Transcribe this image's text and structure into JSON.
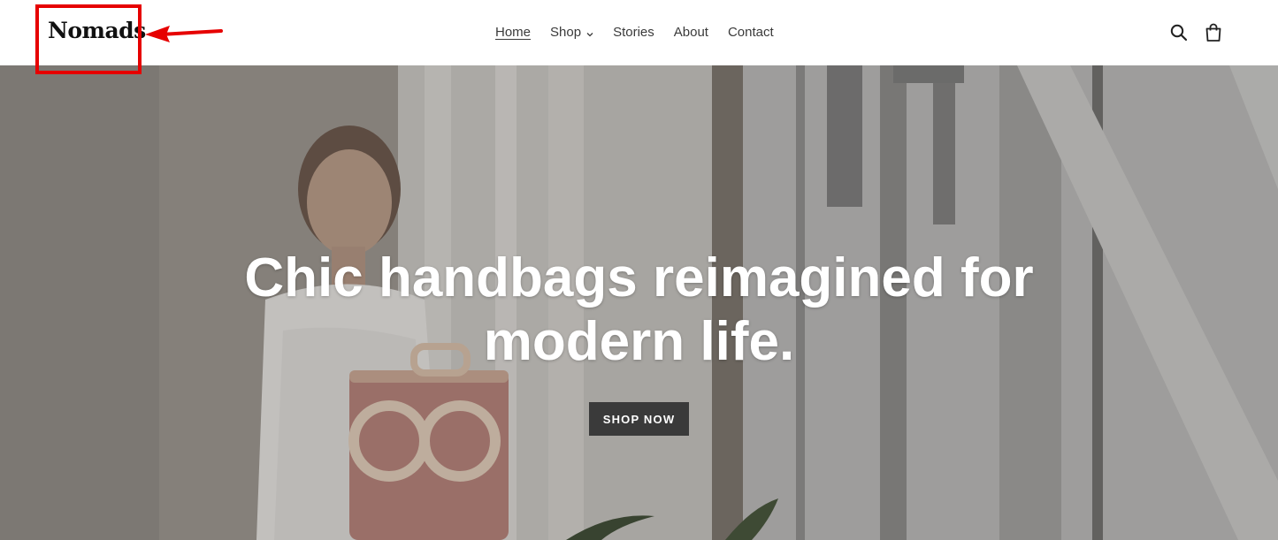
{
  "header": {
    "logo_text": "Nomads",
    "nav": [
      {
        "label": "Home",
        "active": true
      },
      {
        "label": "Shop",
        "has_dropdown": true
      },
      {
        "label": "Stories"
      },
      {
        "label": "About"
      },
      {
        "label": "Contact"
      }
    ],
    "icons": [
      "search-icon",
      "cart-icon"
    ]
  },
  "hero": {
    "title_line1": "Chic handbags reimagined for",
    "title_line2": "modern life.",
    "cta_label": "SHOP NOW"
  },
  "colors": {
    "annotation": "#e60000",
    "cta_background": "#3a3a3a",
    "nav_text": "#3a3a3a"
  }
}
